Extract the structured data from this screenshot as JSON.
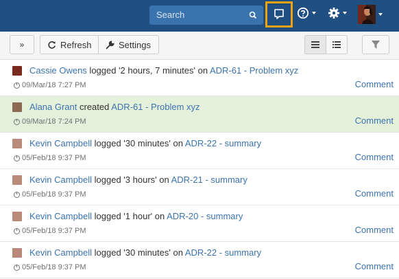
{
  "header": {
    "search_placeholder": "Search",
    "icons": [
      "search-icon",
      "feed-icon",
      "help-icon",
      "gear-icon",
      "user-avatar"
    ],
    "colors": {
      "bar": "#205081",
      "search_bg": "#3b73af",
      "highlight": "#f0a30a"
    }
  },
  "toolbar": {
    "expand_label": "»",
    "refresh_label": "Refresh",
    "settings_label": "Settings",
    "view_icons": [
      "list-compact-icon",
      "list-detail-icon",
      "filter-icon"
    ]
  },
  "feed": {
    "comment_label": "Comment",
    "items": [
      {
        "user": "Cassie Owens",
        "action": " logged '2 hours, 7 minutes' on ",
        "issue": "ADR-61 - Problem xyz",
        "time": "09/Mar/18 7:27 PM",
        "highlighted": false,
        "avatar_color": "#7a2a1e"
      },
      {
        "user": "Alana Grant",
        "action": " created ",
        "issue": "ADR-61 - Problem xyz",
        "time": "09/Mar/18 7:24 PM",
        "highlighted": true,
        "avatar_color": "#8a6a52"
      },
      {
        "user": "Kevin Campbell",
        "action": " logged '30 minutes' on ",
        "issue": "ADR-22 - summary",
        "time": "05/Feb/18 9:37 PM",
        "highlighted": false,
        "avatar_color": "#b9897a"
      },
      {
        "user": "Kevin Campbell",
        "action": " logged '3 hours' on ",
        "issue": "ADR-21 - summary",
        "time": "05/Feb/18 9:37 PM",
        "highlighted": false,
        "avatar_color": "#b9897a"
      },
      {
        "user": "Kevin Campbell",
        "action": " logged '1 hour' on ",
        "issue": "ADR-20 - summary",
        "time": "05/Feb/18 9:37 PM",
        "highlighted": false,
        "avatar_color": "#b9897a"
      },
      {
        "user": "Kevin Campbell",
        "action": " logged '30 minutes' on ",
        "issue": "ADR-22 - summary",
        "time": "05/Feb/18 9:37 PM",
        "highlighted": false,
        "avatar_color": "#b9897a"
      }
    ]
  }
}
